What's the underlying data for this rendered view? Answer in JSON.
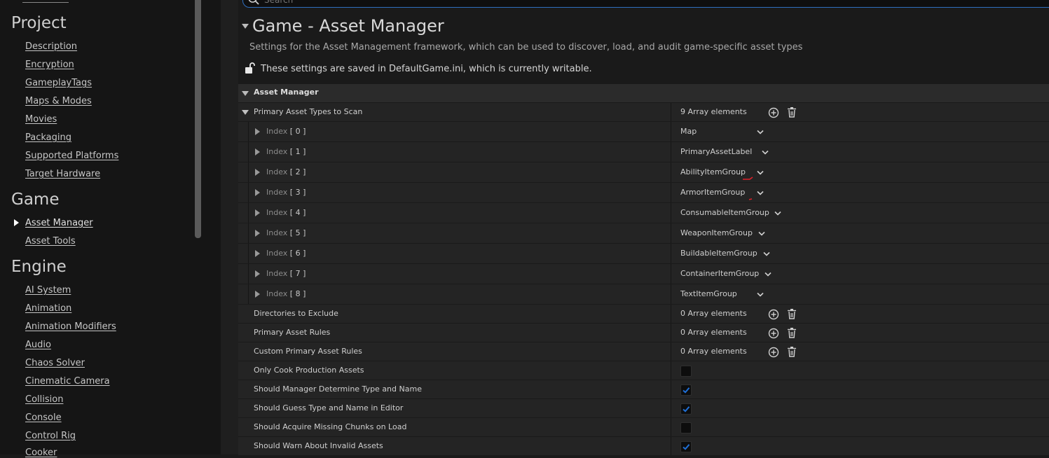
{
  "sidebar": {
    "sections": [
      {
        "title": "Project",
        "items": [
          "Description",
          "Encryption",
          "GameplayTags",
          "Maps & Modes",
          "Movies",
          "Packaging",
          "Supported Platforms",
          "Target Hardware"
        ]
      },
      {
        "title": "Game",
        "items": [
          "Asset Manager",
          "Asset Tools"
        ],
        "active": "Asset Manager"
      },
      {
        "title": "Engine",
        "items": [
          "AI System",
          "Animation",
          "Animation Modifiers",
          "Audio",
          "Chaos Solver",
          "Cinematic Camera",
          "Collision",
          "Console",
          "Control Rig",
          "Cooker"
        ]
      }
    ]
  },
  "search": {
    "placeholder": "Search"
  },
  "header": {
    "title": "Game - Asset Manager",
    "description": "Settings for the Asset Management framework, which can be used to discover, load, and audit game-specific asset types",
    "writable_note": "These settings are saved in DefaultGame.ini, which is currently writable."
  },
  "section": {
    "label": "Asset Manager"
  },
  "primary_asset_types": {
    "label": "Primary Asset Types to Scan",
    "count": "9 Array elements",
    "indices": [
      {
        "index_label": "Index",
        "index_num": "[ 0 ]",
        "value": "Map"
      },
      {
        "index_label": "Index",
        "index_num": "[ 1 ]",
        "value": "PrimaryAssetLabel"
      },
      {
        "index_label": "Index",
        "index_num": "[ 2 ]",
        "value": "AbilityItemGroup"
      },
      {
        "index_label": "Index",
        "index_num": "[ 3 ]",
        "value": "ArmorItemGroup"
      },
      {
        "index_label": "Index",
        "index_num": "[ 4 ]",
        "value": "ConsumableItemGroup"
      },
      {
        "index_label": "Index",
        "index_num": "[ 5 ]",
        "value": "WeaponItemGroup"
      },
      {
        "index_label": "Index",
        "index_num": "[ 6 ]",
        "value": "BuildableItemGroup"
      },
      {
        "index_label": "Index",
        "index_num": "[ 7 ]",
        "value": "ContainerItemGroup"
      },
      {
        "index_label": "Index",
        "index_num": "[ 8 ]",
        "value": "TextItemGroup"
      }
    ]
  },
  "arrays": [
    {
      "label": "Directories to Exclude",
      "count": "0 Array elements"
    },
    {
      "label": "Primary Asset Rules",
      "count": "0 Array elements"
    },
    {
      "label": "Custom Primary Asset Rules",
      "count": "0 Array elements"
    }
  ],
  "booleans": [
    {
      "label": "Only Cook Production Assets",
      "checked": false
    },
    {
      "label": "Should Manager Determine Type and Name",
      "checked": true
    },
    {
      "label": "Should Guess Type and Name in Editor",
      "checked": true
    },
    {
      "label": "Should Acquire Missing Chunks on Load",
      "checked": false
    },
    {
      "label": "Should Warn About Invalid Assets",
      "checked": true
    }
  ],
  "colors": {
    "accent": "#2f6fbf",
    "check": "#1f6fd6",
    "annotation": "#e0202a"
  }
}
